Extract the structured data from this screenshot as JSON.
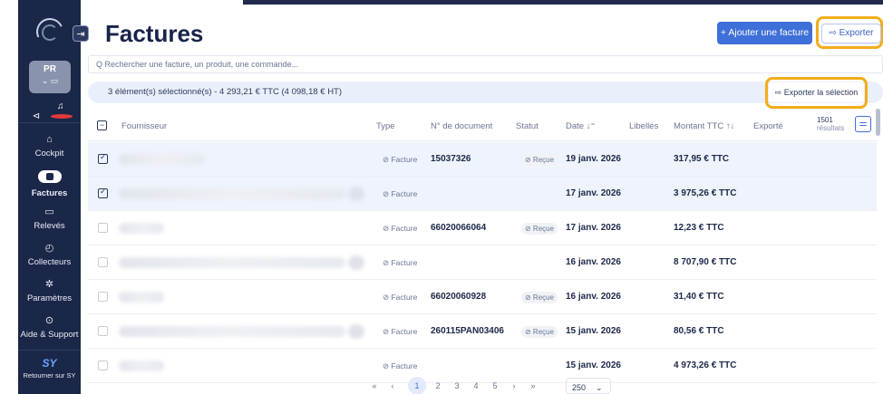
{
  "sidebar": {
    "org": {
      "initials": "PR",
      "sub": "⌄ ▭"
    },
    "mini": [
      "⊲",
      "♫"
    ],
    "items": [
      {
        "label": "Cockpit",
        "icon": "home-icon",
        "glyph": "⌂"
      },
      {
        "label": "Factures",
        "icon": "invoice-icon",
        "glyph": ""
      },
      {
        "label": "Relevés",
        "icon": "statement-icon",
        "glyph": "▭"
      },
      {
        "label": "Collecteurs",
        "icon": "collector-icon",
        "glyph": "◴"
      },
      {
        "label": "Paramètres",
        "icon": "settings-icon",
        "glyph": "✲"
      },
      {
        "label": "Aide & Support",
        "icon": "help-icon",
        "glyph": "⊙"
      }
    ],
    "back": {
      "glyph": "SY",
      "label": "Retourner sur SY"
    }
  },
  "header": {
    "title": "Factures",
    "add_label": "+ Ajouter une facture",
    "export_label": "⇨ Exporter",
    "collapse_glyph": "⇥"
  },
  "search": {
    "placeholder": "Q Rechercher une facture, un produit, une commande..."
  },
  "selection": {
    "text": "3 élément(s) sélectionné(s) - 4 293,21 € TTC (4 098,18 € HT)",
    "export_label": "⇨ Exporter la sélection"
  },
  "table": {
    "headers": {
      "supplier": "Fournisseur",
      "type": "Type",
      "docnum": "N° de document",
      "status": "Statut",
      "date": "Date ↓⁼",
      "labels": "Libellés",
      "amount": "Montant TTC ↑↓",
      "exported": "Exporté"
    },
    "results_count": "1501",
    "results_label": "résultats",
    "rows": [
      {
        "selected": true,
        "type": "⊘ Facture",
        "docnum": "15037326",
        "status": "⊘ Reçue",
        "date": "19 janv. 2026",
        "amount": "317,95 € TTC"
      },
      {
        "selected": true,
        "type": "⊘ Facture",
        "docnum": "",
        "status": "",
        "date": "17 janv. 2026",
        "amount": "3 975,26 € TTC"
      },
      {
        "selected": false,
        "type": "⊘ Facture",
        "docnum": "66020066064",
        "status": "⊘ Reçue",
        "date": "17 janv. 2026",
        "amount": "12,23 € TTC"
      },
      {
        "selected": false,
        "type": "⊘ Facture",
        "docnum": "",
        "status": "",
        "date": "16 janv. 2026",
        "amount": "8 707,90 € TTC"
      },
      {
        "selected": false,
        "type": "⊘ Facture",
        "docnum": "66020060928",
        "status": "⊘ Reçue",
        "date": "16 janv. 2026",
        "amount": "31,40 € TTC"
      },
      {
        "selected": false,
        "type": "⊘ Facture",
        "docnum": "260115PAN03406",
        "status": "⊘ Reçue",
        "date": "15 janv. 2026",
        "amount": "80,56 € TTC"
      },
      {
        "selected": false,
        "type": "⊘ Facture",
        "docnum": "",
        "status": "",
        "date": "15 janv. 2026",
        "amount": "4 973,26 € TTC"
      }
    ]
  },
  "pagination": {
    "first": "«",
    "prev": "‹",
    "pages": [
      "1",
      "2",
      "3",
      "4",
      "5"
    ],
    "next": "›",
    "last": "»",
    "page_size": "250"
  },
  "colors": {
    "sidebar": "#1b2749",
    "accent": "#3f6fd8",
    "highlight": "#f1ad1a"
  }
}
